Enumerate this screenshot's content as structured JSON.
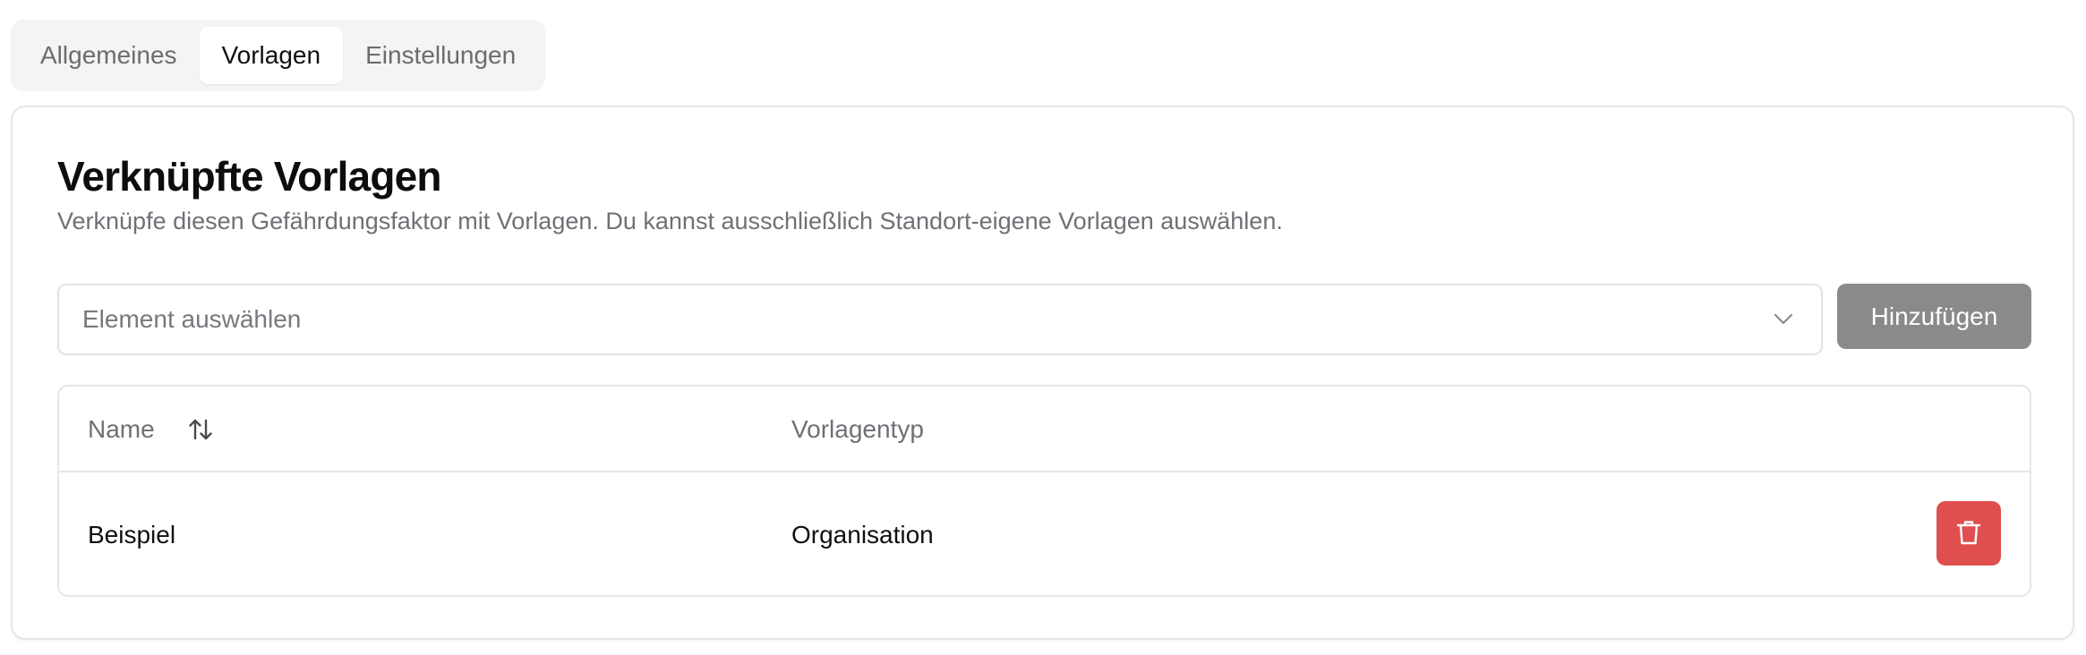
{
  "tabs": [
    {
      "label": "Allgemeines",
      "active": false
    },
    {
      "label": "Vorlagen",
      "active": true
    },
    {
      "label": "Einstellungen",
      "active": false
    }
  ],
  "card": {
    "title": "Verknüpfte Vorlagen",
    "description": "Verknüpfe diesen Gefährdungsfaktor mit Vorlagen. Du kannst ausschließlich Standort-eigene Vorlagen auswählen."
  },
  "select": {
    "placeholder": "Element auswählen",
    "icon": "chevron-down-icon"
  },
  "add_button": {
    "label": "Hinzufügen",
    "color": "#8a8a8a"
  },
  "table": {
    "columns": [
      "Name",
      "Vorlagentyp"
    ],
    "sort_icon": "sort-arrows-icon",
    "rows": [
      {
        "name": "Beispiel",
        "type": "Organisation",
        "delete_icon": "trash-icon"
      }
    ]
  },
  "colors": {
    "delete": "#e04f4f",
    "tabs_bg": "#f4f4f5",
    "border": "#e6e6e8"
  }
}
